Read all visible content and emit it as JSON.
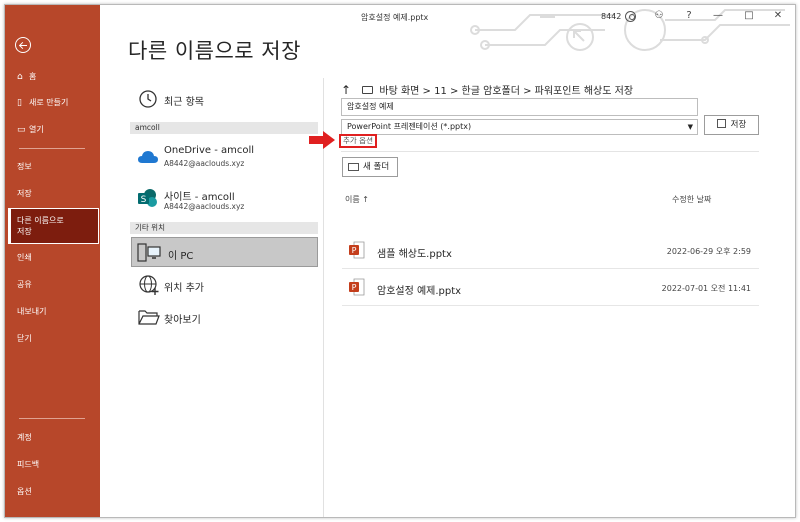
{
  "window": {
    "title": "암호설정 예제.pptx",
    "user": "8442",
    "help": "?",
    "minimize": "—",
    "maximize": "□",
    "close": "✕"
  },
  "rail": {
    "home": "홈",
    "new": "새로 만들기",
    "open": "열기",
    "info": "정보",
    "save": "저장",
    "save_as": "다른 이름으로\n저장",
    "print": "인쇄",
    "share": "공유",
    "export": "내보내기",
    "close": "닫기",
    "account": "계정",
    "feedback": "피드백",
    "options": "옵션"
  },
  "page_title": "다른 이름으로 저장",
  "locations": {
    "recent": "최근 항목",
    "account_section": "amcoll",
    "onedrive": {
      "label": "OneDrive - amcoll",
      "email": "A8442@aaclouds.xyz"
    },
    "sites": {
      "label": "사이트 - amcoll",
      "email": "A8442@aaclouds.xyz"
    },
    "other_section": "기타 위치",
    "this_pc": "이 PC",
    "add_place": "위치 추가",
    "browse": "찾아보기"
  },
  "path": {
    "up": "↑",
    "breadcrumb": "바탕 화면 > 11 > 한글 암호폴더 > 파워포인트 해상도 저장"
  },
  "filename_value": "암호설정 예제",
  "filetype_value": "PowerPoint 프레젠테이션 (*.pptx)",
  "save_button": "저장",
  "more_options": "추가 옵션",
  "new_folder": "새 폴더",
  "columns": {
    "name": "이름 ↑",
    "modified": "수정한 날짜"
  },
  "files": [
    {
      "name": "샘플 해상도.pptx",
      "date": "2022-06-29 오후 2:59"
    },
    {
      "name": "암호설정 예제.pptx",
      "date": "2022-07-01 오전 11:41"
    }
  ],
  "colors": {
    "accent": "#b7472a",
    "selected_rail": "#7d1d0e",
    "highlight": "#e02020"
  }
}
